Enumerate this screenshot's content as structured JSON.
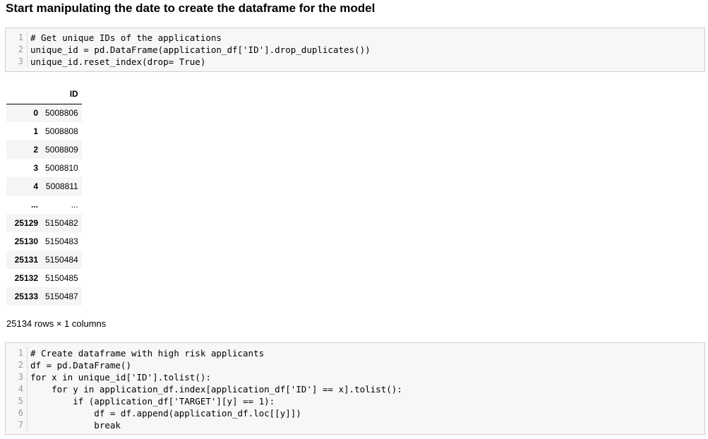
{
  "heading": "Start manipulating the date to create the dataframe for the model",
  "cell1": {
    "lines": [
      {
        "no": "1",
        "code": "# Get unique IDs of the applications"
      },
      {
        "no": "2",
        "code": "unique_id = pd.DataFrame(application_df['ID'].drop_duplicates())"
      },
      {
        "no": "3",
        "code": "unique_id.reset_index(drop= True)"
      }
    ]
  },
  "output": {
    "column_header": "ID",
    "rows": [
      {
        "index": "0",
        "value": "5008806"
      },
      {
        "index": "1",
        "value": "5008808"
      },
      {
        "index": "2",
        "value": "5008809"
      },
      {
        "index": "3",
        "value": "5008810"
      },
      {
        "index": "4",
        "value": "5008811"
      },
      {
        "index": "...",
        "value": "..."
      },
      {
        "index": "25129",
        "value": "5150482"
      },
      {
        "index": "25130",
        "value": "5150483"
      },
      {
        "index": "25131",
        "value": "5150484"
      },
      {
        "index": "25132",
        "value": "5150485"
      },
      {
        "index": "25133",
        "value": "5150487"
      }
    ],
    "shape_text": "25134 rows × 1 columns"
  },
  "cell2": {
    "lines": [
      {
        "no": "1",
        "code": "# Create dataframe with high risk applicants"
      },
      {
        "no": "2",
        "code": "df = pd.DataFrame()"
      },
      {
        "no": "3",
        "code": "for x in unique_id['ID'].tolist():"
      },
      {
        "no": "4",
        "code": "    for y in application_df.index[application_df['ID'] == x].tolist():"
      },
      {
        "no": "5",
        "code": "        if (application_df['TARGET'][y] == 1):"
      },
      {
        "no": "6",
        "code": "            df = df.append(application_df.loc[[y]])"
      },
      {
        "no": "7",
        "code": "            break"
      }
    ]
  }
}
